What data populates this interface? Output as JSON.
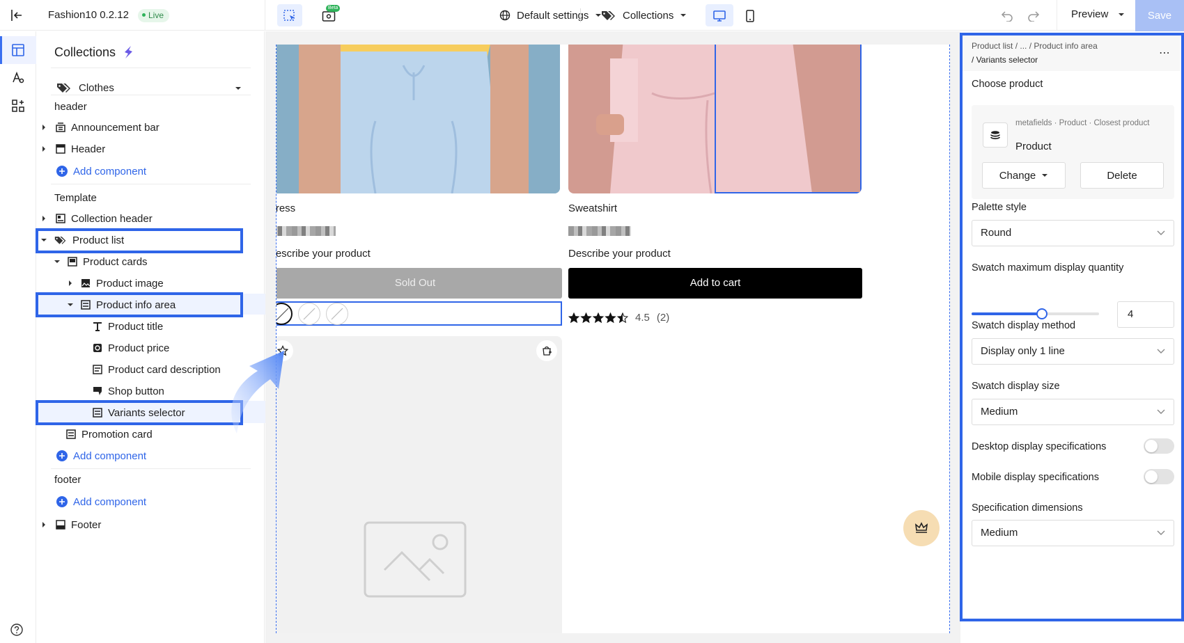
{
  "app": {
    "title": "Fashion10 0.2.12",
    "status_badge": "Live",
    "beta_tag": "Beta",
    "settings_dropdown": "Default settings",
    "template_dropdown": "Collections",
    "preview_label": "Preview",
    "save_label": "Save"
  },
  "structure_panel": {
    "title": "Collections",
    "collection_select": "Clothes",
    "sections": {
      "header_label": "header",
      "template_label": "Template",
      "footer_label": "footer"
    },
    "items": {
      "announcement_bar": "Announcement bar",
      "header": "Header",
      "collection_header": "Collection header",
      "product_list": "Product list",
      "product_cards": "Product cards",
      "product_image": "Product image",
      "product_info_area": "Product info area",
      "product_title": "Product title",
      "product_price": "Product price",
      "product_card_description": "Product card description",
      "shop_button": "Shop button",
      "variants_selector": "Variants selector",
      "promotion_card": "Promotion card",
      "footer": "Footer"
    },
    "add_component_label": "Add component"
  },
  "canvas": {
    "products": [
      {
        "name": "Dress",
        "description": "Describe your product",
        "button": "Sold Out"
      },
      {
        "name": "Sweatshirt",
        "description": "Describe your product",
        "button": "Add to cart",
        "rating": "4.5",
        "rating_count": "(2)",
        "rating_value": 4.5
      }
    ]
  },
  "settings_panel": {
    "breadcrumb_path": "Product list / ... / Product info area",
    "breadcrumb_current": "/ Variants selector",
    "choose_product_label": "Choose product",
    "source_path": "metafields · Product · Closest product",
    "source_name": "Product",
    "change_button": "Change",
    "delete_button": "Delete",
    "palette_style_label": "Palette style",
    "palette_style_value": "Round",
    "swatch_max_label": "Swatch maximum display quantity",
    "swatch_max_value": "4",
    "swatch_max_slider_fraction": 0.55,
    "swatch_method_label": "Swatch display method",
    "swatch_method_value": "Display only 1 line",
    "swatch_size_label": "Swatch display size",
    "swatch_size_value": "Medium",
    "desktop_spec_label": "Desktop display specifications",
    "mobile_spec_label": "Mobile display specifications",
    "spec_dimensions_label": "Specification dimensions",
    "spec_dimensions_value": "Medium"
  },
  "colors": {
    "accent": "#2f65e8",
    "save_button": "#a9c0f5",
    "sold_out": "#a8a8a8",
    "add_to_cart": "#000000"
  }
}
